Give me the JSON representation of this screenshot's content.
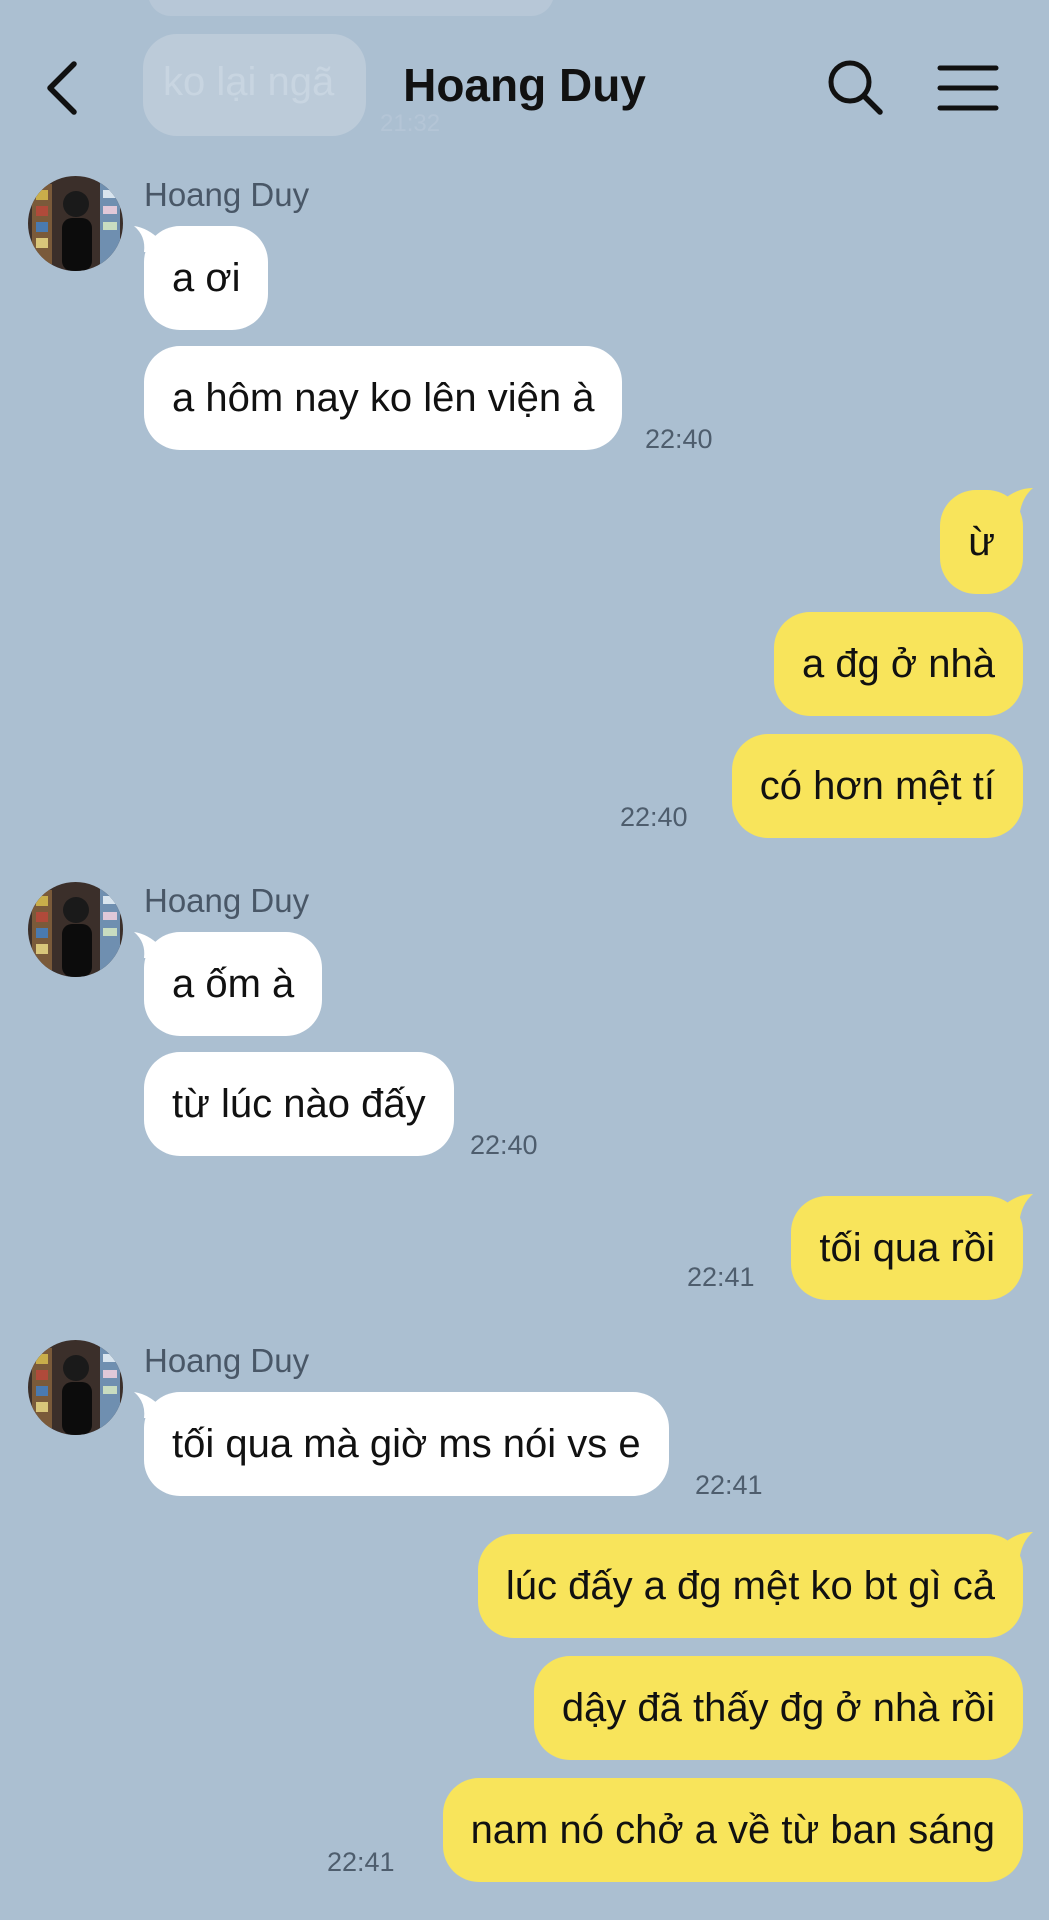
{
  "header": {
    "title": "Hoang Duy"
  },
  "ghost": {
    "text": "ko lại ngã",
    "time": "21:32"
  },
  "messages": {
    "g1_sender": "Hoang Duy",
    "g1_m1": "a ơi",
    "g1_m2": "a hôm nay ko lên viện à",
    "g1_time": "22:40",
    "g2_m1": "ừ",
    "g2_m2": "a đg ở nhà",
    "g2_m3": "có hơn mệt tí",
    "g2_time": "22:40",
    "g3_sender": "Hoang Duy",
    "g3_m1": "a ốm à",
    "g3_m2": "từ lúc nào đấy",
    "g3_time": "22:40",
    "g4_m1": "tối qua rồi",
    "g4_time": "22:41",
    "g5_sender": "Hoang Duy",
    "g5_m1": "tối qua mà giờ ms nói vs e",
    "g5_time": "22:41",
    "g6_m1": "lúc đấy a đg mệt ko bt gì cả",
    "g6_m2": "dậy đã thấy đg ở nhà rồi",
    "g6_m3": "nam nó chở a về từ ban sáng",
    "g6_time": "22:41"
  },
  "colors": {
    "background": "#abbfd1",
    "incoming_bubble": "#ffffff",
    "outgoing_bubble": "#f8e45b",
    "timestamp": "#4e5d6d",
    "sender_name": "#495767"
  },
  "icons": {
    "back": "back-icon",
    "search": "search-icon",
    "menu": "menu-icon"
  }
}
